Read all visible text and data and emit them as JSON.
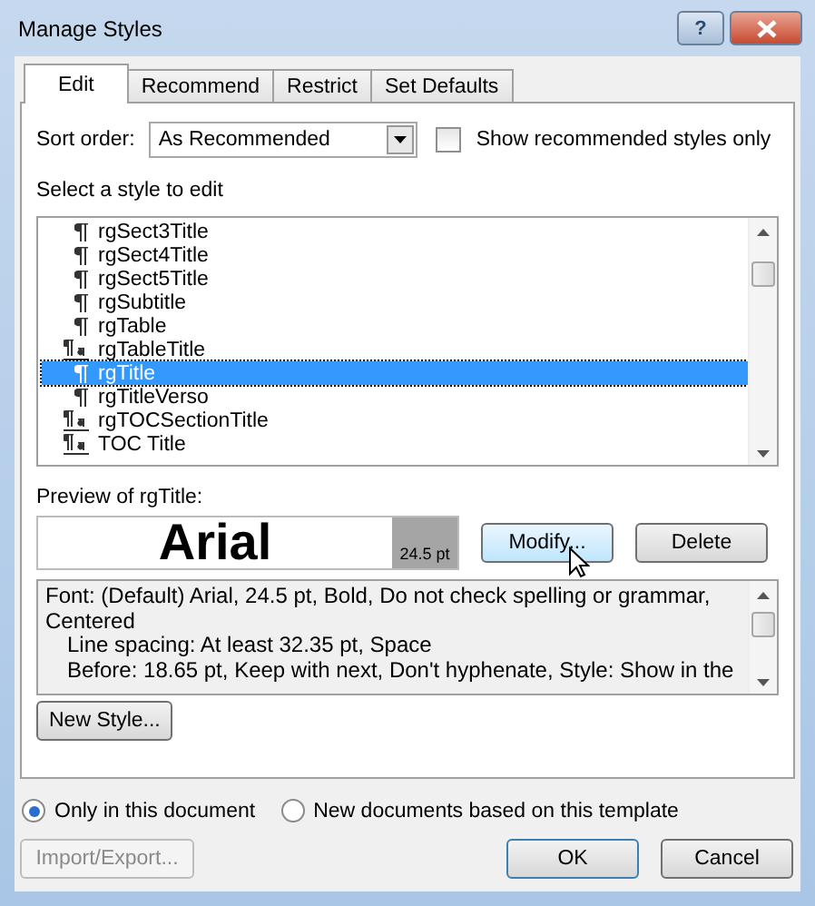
{
  "window": {
    "title": "Manage Styles",
    "buttons": [
      {
        "kind": "help",
        "label": "?"
      },
      {
        "kind": "close"
      }
    ]
  },
  "tabs": [
    {
      "label": "Edit",
      "selected": true
    },
    {
      "label": "Recommend",
      "selected": false
    },
    {
      "label": "Restrict",
      "selected": false
    },
    {
      "label": "Set Defaults",
      "selected": false
    }
  ],
  "sort_order": {
    "label": "Sort order:",
    "value": "As Recommended"
  },
  "show_recommended": {
    "label": "Show recommended styles only",
    "checked": false
  },
  "style_list": {
    "label": "Select a style to edit",
    "items": [
      {
        "name": "rgSect3Title",
        "kind": "paragraph",
        "selected": false
      },
      {
        "name": "rgSect4Title",
        "kind": "paragraph",
        "selected": false
      },
      {
        "name": "rgSect5Title",
        "kind": "paragraph",
        "selected": false
      },
      {
        "name": "rgSubtitle",
        "kind": "paragraph",
        "selected": false
      },
      {
        "name": "rgTable",
        "kind": "paragraph",
        "selected": false
      },
      {
        "name": "rgTableTitle",
        "kind": "linked",
        "selected": false
      },
      {
        "name": "rgTitle",
        "kind": "paragraph",
        "selected": true
      },
      {
        "name": "rgTitleVerso",
        "kind": "paragraph",
        "selected": false
      },
      {
        "name": "rgTOCSectionTitle",
        "kind": "linked",
        "selected": false
      },
      {
        "name": "TOC Title",
        "kind": "linked",
        "selected": false
      }
    ]
  },
  "preview": {
    "label": "Preview of rgTitle:",
    "sample": "Arial",
    "size": "24.5 pt"
  },
  "buttons": {
    "modify": "Modify...",
    "delete": "Delete",
    "new_style": "New Style..."
  },
  "description": [
    {
      "text": "Font: (Default) Arial, 24.5 pt, Bold, Do not check spelling or grammar,",
      "indented": false
    },
    {
      "text": "Centered",
      "indented": false
    },
    {
      "text": "Line spacing:  At least 32.35 pt, Space",
      "indented": true
    },
    {
      "text": "Before:  18.65 pt, Keep with next, Don't hyphenate, Style: Show in the",
      "indented": true
    }
  ],
  "scope": [
    {
      "label": "Only in this document",
      "selected": true
    },
    {
      "label": "New documents based on this template",
      "selected": false
    }
  ],
  "footer": [
    {
      "label": "Import/Export...",
      "disabled": true,
      "default": false
    },
    {
      "label": "OK",
      "disabled": false,
      "default": true
    },
    {
      "label": "Cancel",
      "disabled": false,
      "default": false
    }
  ]
}
